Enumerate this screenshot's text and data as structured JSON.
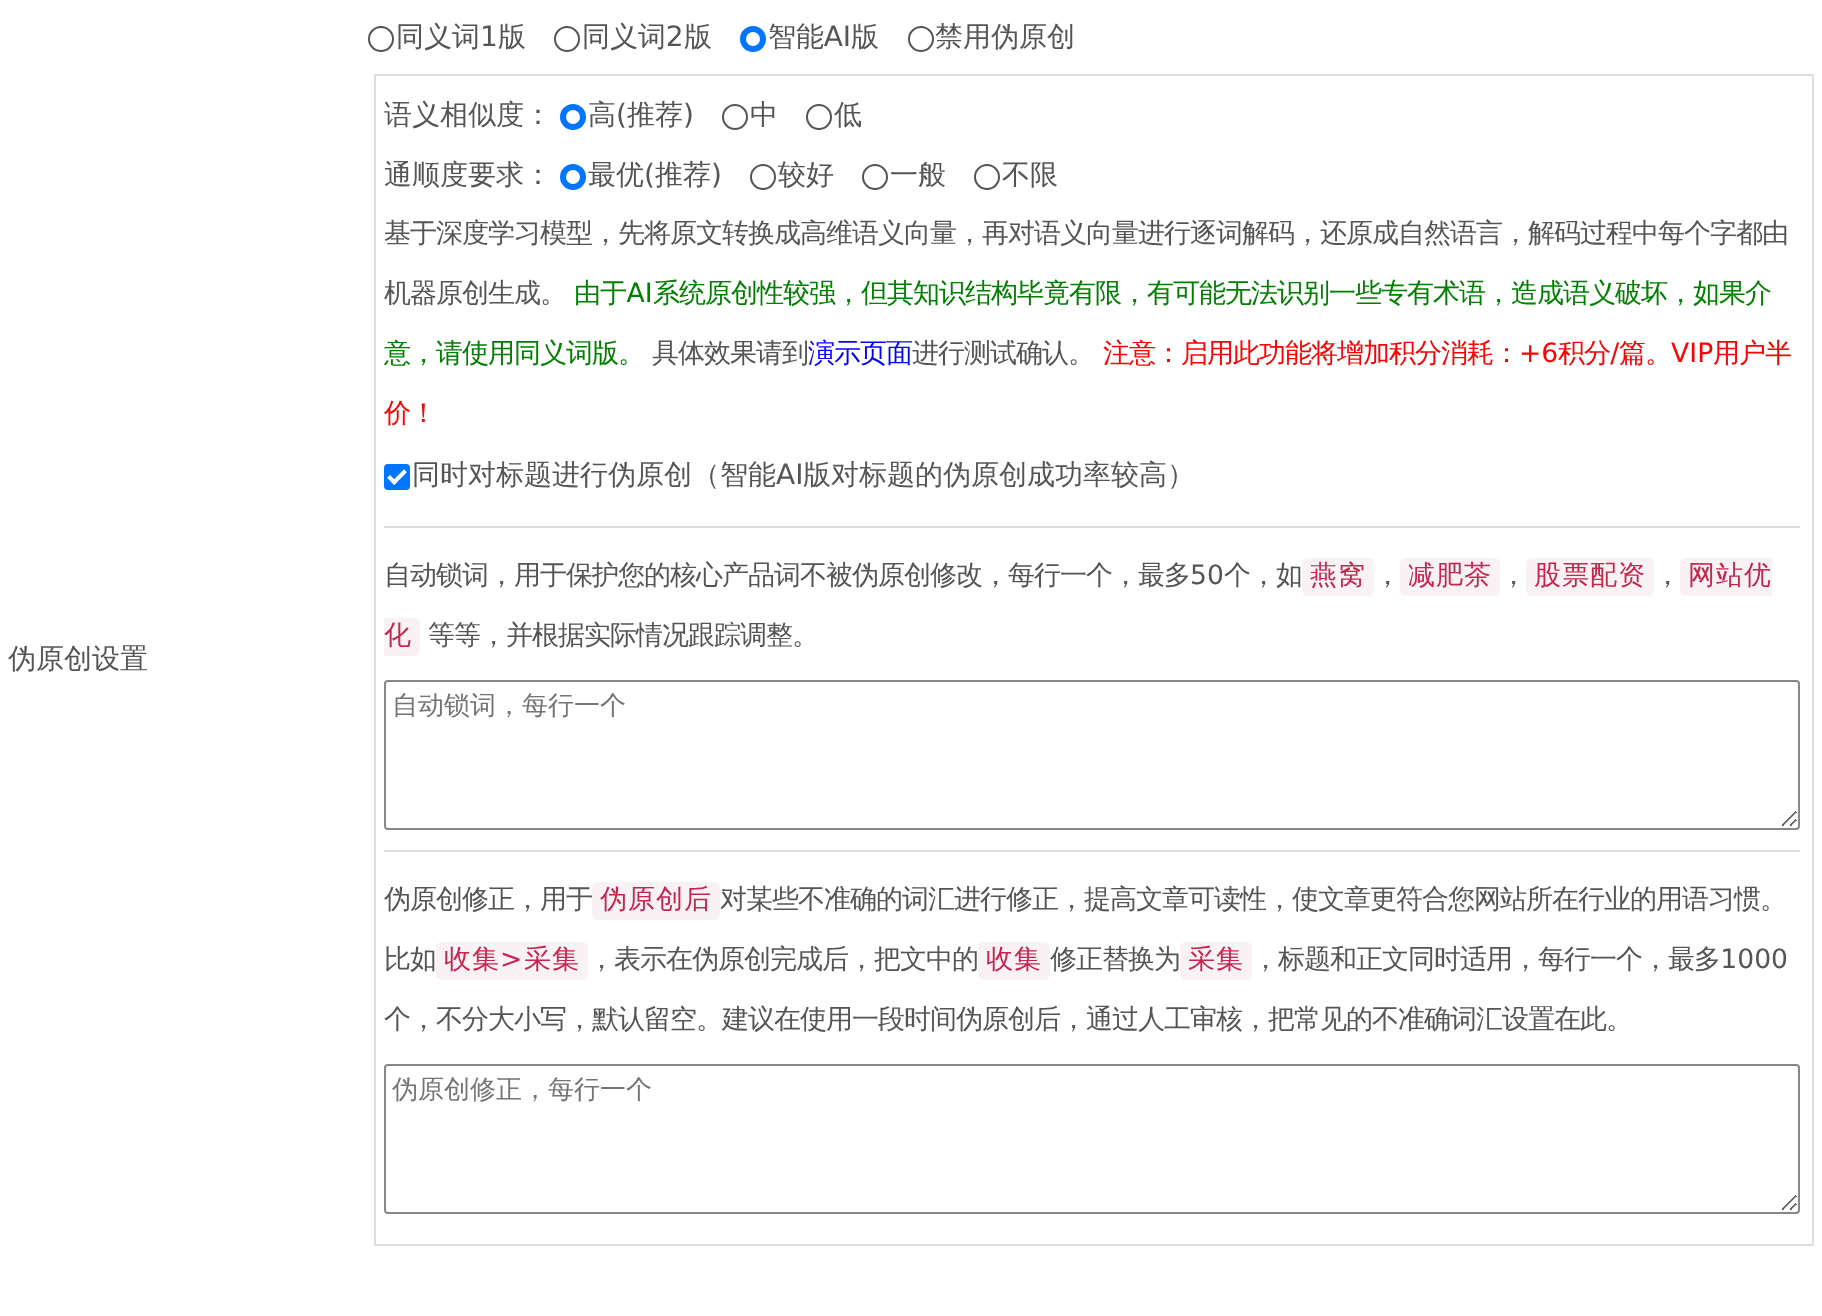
{
  "row_label": "伪原创设置",
  "modes": [
    {
      "label": "同义词1版",
      "selected": false
    },
    {
      "label": "同义词2版",
      "selected": false
    },
    {
      "label": "智能AI版",
      "selected": true
    },
    {
      "label": "禁用伪原创",
      "selected": false
    }
  ],
  "similarity": {
    "label": "语义相似度：",
    "options": [
      {
        "label": "高(推荐)",
        "selected": true
      },
      {
        "label": "中",
        "selected": false
      },
      {
        "label": "低",
        "selected": false
      }
    ]
  },
  "fluency": {
    "label": "通顺度要求：",
    "options": [
      {
        "label": "最优(推荐)",
        "selected": true
      },
      {
        "label": "较好",
        "selected": false
      },
      {
        "label": "一般",
        "selected": false
      },
      {
        "label": "不限",
        "selected": false
      }
    ]
  },
  "ai_description": [
    {
      "kind": "plain",
      "text": "基于深度学习模型，先将原文转换成高维语义向量，再对语义向量进行逐词解码，还原成自然语言，解码过程中每个字都由机器原创生成。 "
    },
    {
      "kind": "notice",
      "text": "由于AI系统原创性较强，但其知识结构毕竟有限，有可能无法识别一些专有术语，造成语义破坏，如果介意，请使用同义词版。"
    },
    {
      "kind": "plain",
      "text": " 具体效果请到"
    },
    {
      "kind": "link",
      "text": "演示页面"
    },
    {
      "kind": "plain",
      "text": "进行测试确认。 "
    },
    {
      "kind": "warning",
      "text": "注意：启用此功能将增加积分消耗：+6积分/篇。VIP用户半价！"
    }
  ],
  "title_option": {
    "label": "同时对标题进行伪原创（智能AI版对标题的伪原创成功率较高）",
    "checked": true
  },
  "lock_words": {
    "description": [
      {
        "kind": "plain",
        "text": "自动锁词，用于保护您的核心产品词不被伪原创修改，每行一个，最多50个，如"
      },
      {
        "kind": "code",
        "text": "燕窝"
      },
      {
        "kind": "plain",
        "text": "，"
      },
      {
        "kind": "code",
        "text": "减肥茶"
      },
      {
        "kind": "plain",
        "text": "，"
      },
      {
        "kind": "code",
        "text": "股票配资"
      },
      {
        "kind": "plain",
        "text": "，"
      },
      {
        "kind": "code",
        "text": "网站优化"
      },
      {
        "kind": "plain",
        "text": " 等等，并根据实际情况跟踪调整。"
      }
    ],
    "placeholder": "自动锁词，每行一个"
  },
  "corrections": {
    "description": [
      {
        "kind": "plain",
        "text": "伪原创修正，用于"
      },
      {
        "kind": "code",
        "text": "伪原创后"
      },
      {
        "kind": "plain",
        "text": "对某些不准确的词汇进行修正，提高文章可读性，使文章更符合您网站所在行业的用语习惯。比如"
      },
      {
        "kind": "code",
        "text": "收集>采集"
      },
      {
        "kind": "plain",
        "text": "，表示在伪原创完成后，把文中的"
      },
      {
        "kind": "code",
        "text": "收集"
      },
      {
        "kind": "plain",
        "text": "修正替换为"
      },
      {
        "kind": "code",
        "text": "采集"
      },
      {
        "kind": "plain",
        "text": "，标题和正文同时适用，每行一个，最多1000个，不分大小写，默认留空。建议在使用一段时间伪原创后，通过人工审核，把常见的不准确词汇设置在此。"
      }
    ],
    "placeholder": "伪原创修正，每行一个"
  }
}
